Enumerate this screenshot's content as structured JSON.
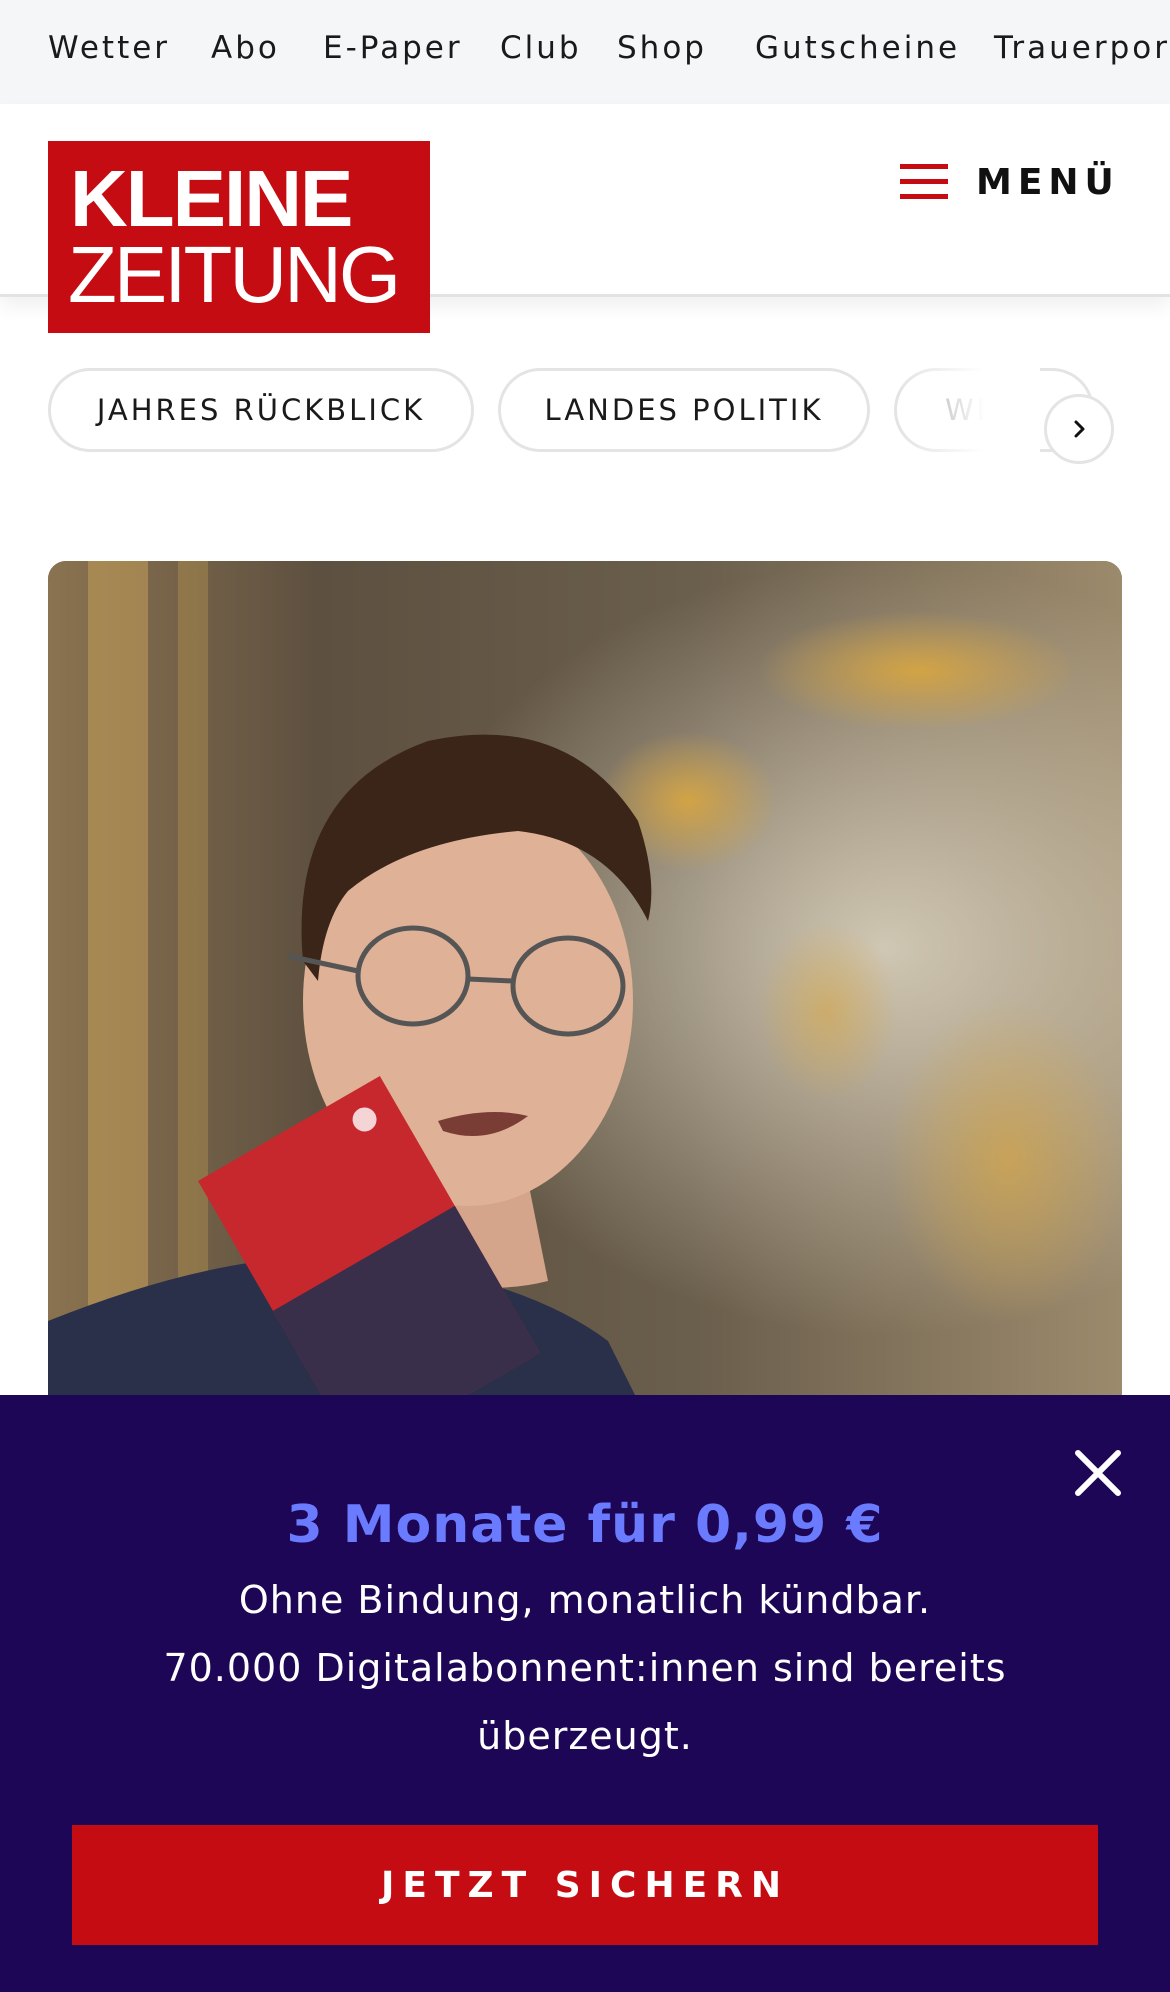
{
  "topnav": {
    "items": [
      "Wetter",
      "Abo",
      "E-Paper",
      "Club",
      "Shop",
      "Gutscheine",
      "Trauerportal"
    ]
  },
  "header": {
    "logo_line1": "KLEINE",
    "logo_line2": "ZEITUNG",
    "menu_label": "MENÜ"
  },
  "categories": {
    "items": [
      "JAHRES RÜCKBLICK",
      "LANDES POLITIK",
      "WELT"
    ]
  },
  "banner": {
    "title": "3 Monate für 0,99 €",
    "line1": "Ohne Bindung, monatlich kündbar.",
    "line2": "70.000 Digitalabonnent:innen sind bereits",
    "line3": "überzeugt.",
    "cta": "JETZT SICHERN"
  },
  "colors": {
    "brand_red": "#c40c12",
    "banner_bg": "#1d0655",
    "offer_accent": "#6b7bff"
  },
  "icons": {
    "menu": "hamburger-icon",
    "chips_next": "chevron-right-icon",
    "banner_close": "close-icon"
  }
}
